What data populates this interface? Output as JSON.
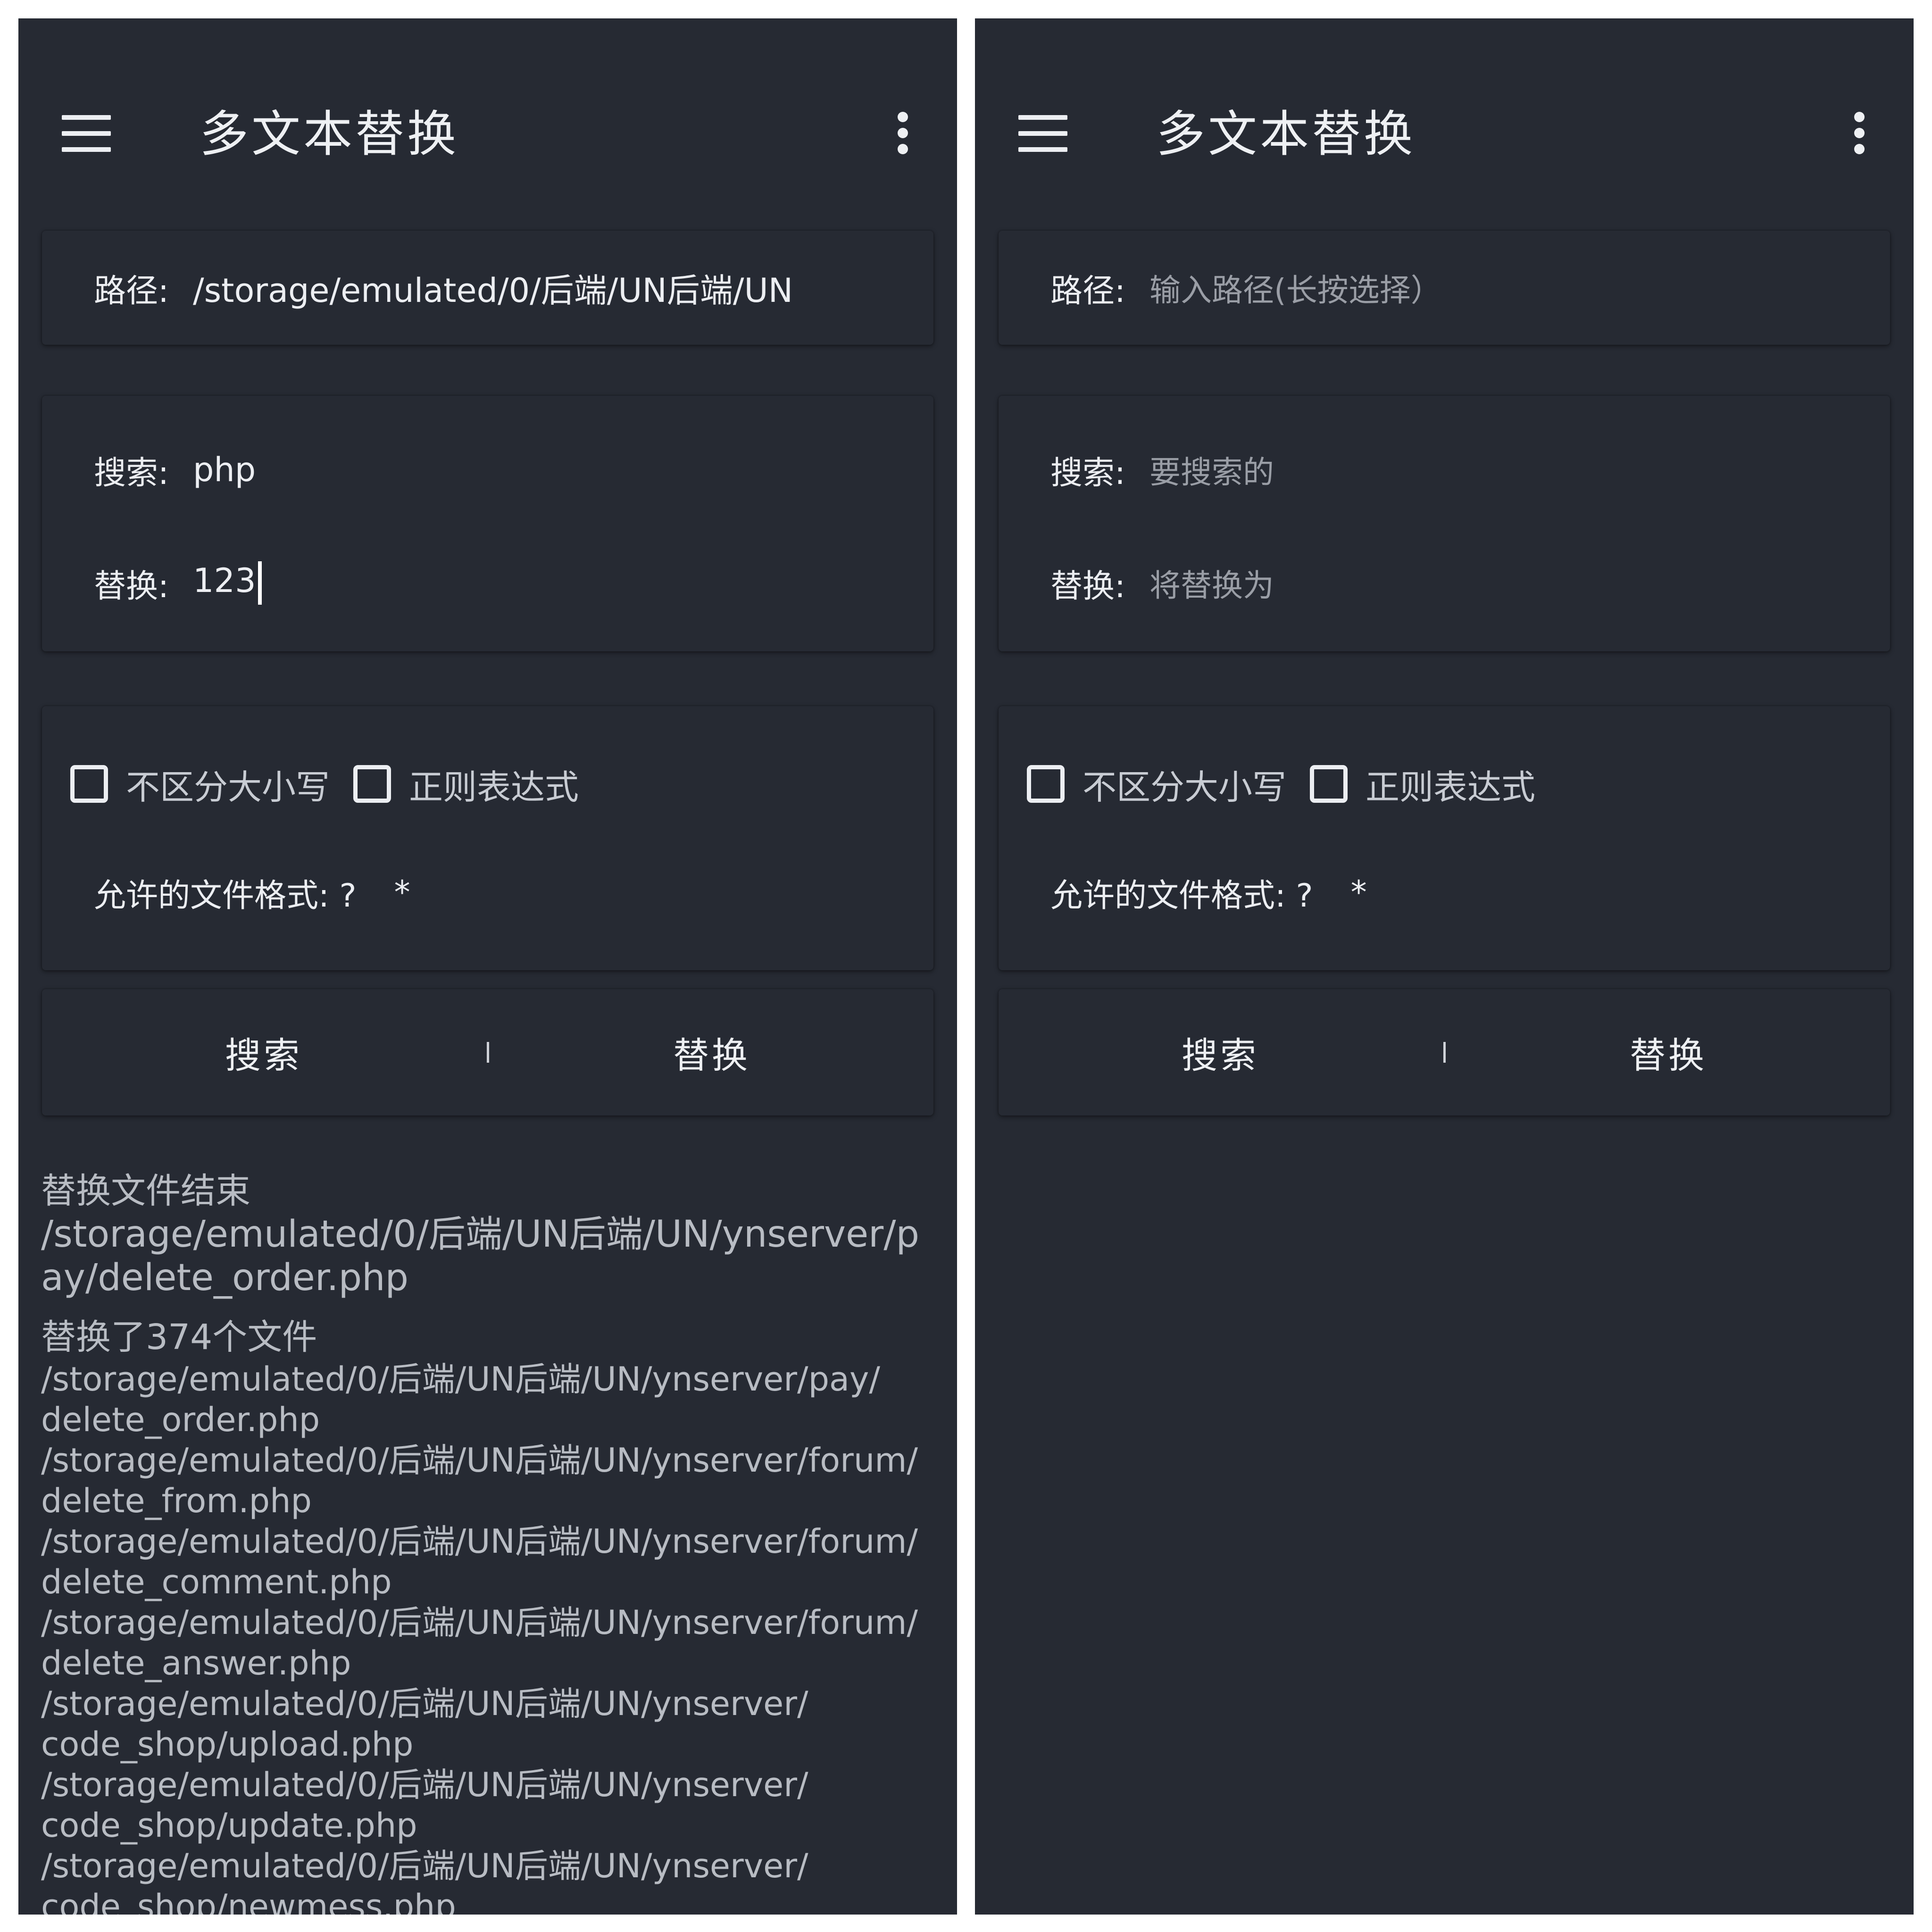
{
  "app": {
    "title": "多文本替换"
  },
  "labels": {
    "path": "路径:",
    "search": "搜索:",
    "replace": "替换:",
    "ignore_case": "不区分大小写",
    "regex": "正则表达式",
    "allowed_formats_label": "允许的文件格式: ?",
    "allowed_formats_value": "*",
    "search_button": "搜索",
    "replace_button": "替换"
  },
  "screens": {
    "left": {
      "path_value": "/storage/emulated/0/后端/UN后端/UN",
      "search_value": "php",
      "replace_value": "123",
      "ignore_case_checked": false,
      "regex_checked": false,
      "log": {
        "block1_header": "替换文件结束",
        "block1_path": "/storage/emulated/0/后端/UN后端/UN/ynserver/pay/delete_order.php",
        "block2_header": "替换了374个文件",
        "lines": [
          "/storage/emulated/0/后端/UN后端/UN/ynserver/pay/",
          "delete_order.php",
          "/storage/emulated/0/后端/UN后端/UN/ynserver/forum/",
          "delete_from.php",
          "/storage/emulated/0/后端/UN后端/UN/ynserver/forum/",
          "delete_comment.php",
          "/storage/emulated/0/后端/UN后端/UN/ynserver/forum/",
          "delete_answer.php",
          "/storage/emulated/0/后端/UN后端/UN/ynserver/",
          "code_shop/upload.php",
          "/storage/emulated/0/后端/UN后端/UN/ynserver/",
          "code_shop/update.php",
          "/storage/emulated/0/后端/UN后端/UN/ynserver/",
          "code_shop/newmess.php"
        ]
      }
    },
    "right": {
      "path_placeholder": "输入路径(长按选择）",
      "search_placeholder": "要搜索的",
      "replace_placeholder": "将替换为",
      "ignore_case_checked": false,
      "regex_checked": false
    }
  },
  "colors": {
    "background": "#262a33",
    "text_primary": "#eceef2",
    "text_secondary": "#b8bcc3",
    "placeholder": "#9a9ea6"
  },
  "icons": {
    "menu": "hamburger-menu-icon",
    "more": "more-vertical-icon",
    "checkbox": "checkbox-unchecked-icon"
  }
}
